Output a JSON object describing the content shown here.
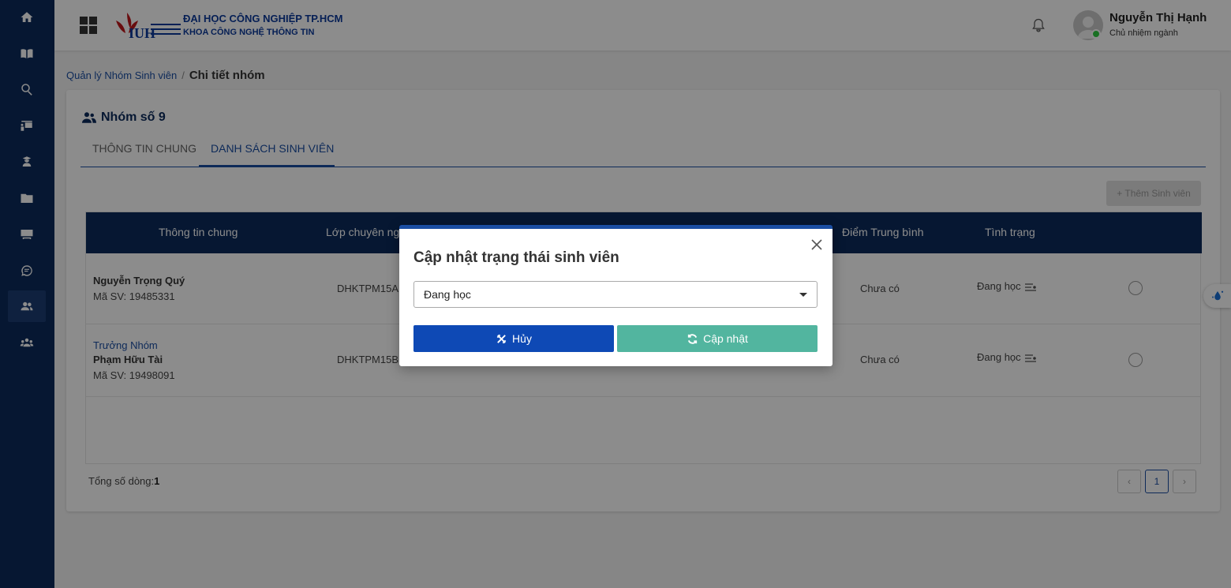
{
  "header": {
    "school_name": "ĐẠI HỌC CÔNG NGHIỆP TP.HCM",
    "faculty_name": "KHOA CÔNG NGHỆ THÔNG TIN",
    "user_name": "Nguyễn Thị Hạnh",
    "user_role": "Chủ nhiệm ngành"
  },
  "sidebar": {
    "items": [
      {
        "icon": "home-icon"
      },
      {
        "icon": "book-icon"
      },
      {
        "icon": "search-icon"
      },
      {
        "icon": "presentation-icon"
      },
      {
        "icon": "student-icon"
      },
      {
        "icon": "folder-icon"
      },
      {
        "icon": "chalkboard-icon"
      },
      {
        "icon": "chat-icon"
      },
      {
        "icon": "users-icon",
        "active": true
      },
      {
        "icon": "group-icon"
      }
    ]
  },
  "breadcrumb": {
    "parent": "Quản lý Nhóm Sinh viên",
    "separator": "/",
    "current": "Chi tiết nhóm"
  },
  "group": {
    "title": "Nhóm số 9",
    "tabs": [
      {
        "label": "THÔNG TIN CHUNG",
        "active": false
      },
      {
        "label": "DANH SÁCH SINH VIÊN",
        "active": true
      }
    ],
    "add_button": "+ Thêm Sinh viên"
  },
  "table": {
    "headers": [
      "Thông tin chung",
      "Lớp chuyên ngà",
      "Điểm Trung bình",
      "Tình trạng"
    ],
    "rows": [
      {
        "role": "",
        "name": "Nguyễn Trọng Quý",
        "student_id": "Mã SV: 19485331",
        "class": "DHKTPM15A",
        "avg_score": "Chưa có",
        "status": "Đang học"
      },
      {
        "role": "Trưởng Nhóm",
        "name": "Phạm Hữu Tài",
        "student_id": "Mã SV: 19498091",
        "class": "DHKTPM15B",
        "avg_score": "Chưa có",
        "status": "Đang học"
      }
    ],
    "total_label": "Tổng số dòng:",
    "total_value": "1",
    "current_page": "1"
  },
  "modal": {
    "title": "Cập nhật trạng thái sinh viên",
    "select_value": "Đang học",
    "cancel_label": "Hủy",
    "update_label": "Cập nhật"
  },
  "colors": {
    "sidebar": "#0b2a5b",
    "primary": "#1a4ea3",
    "cancel": "#0e49b5",
    "update": "#52b59f"
  }
}
